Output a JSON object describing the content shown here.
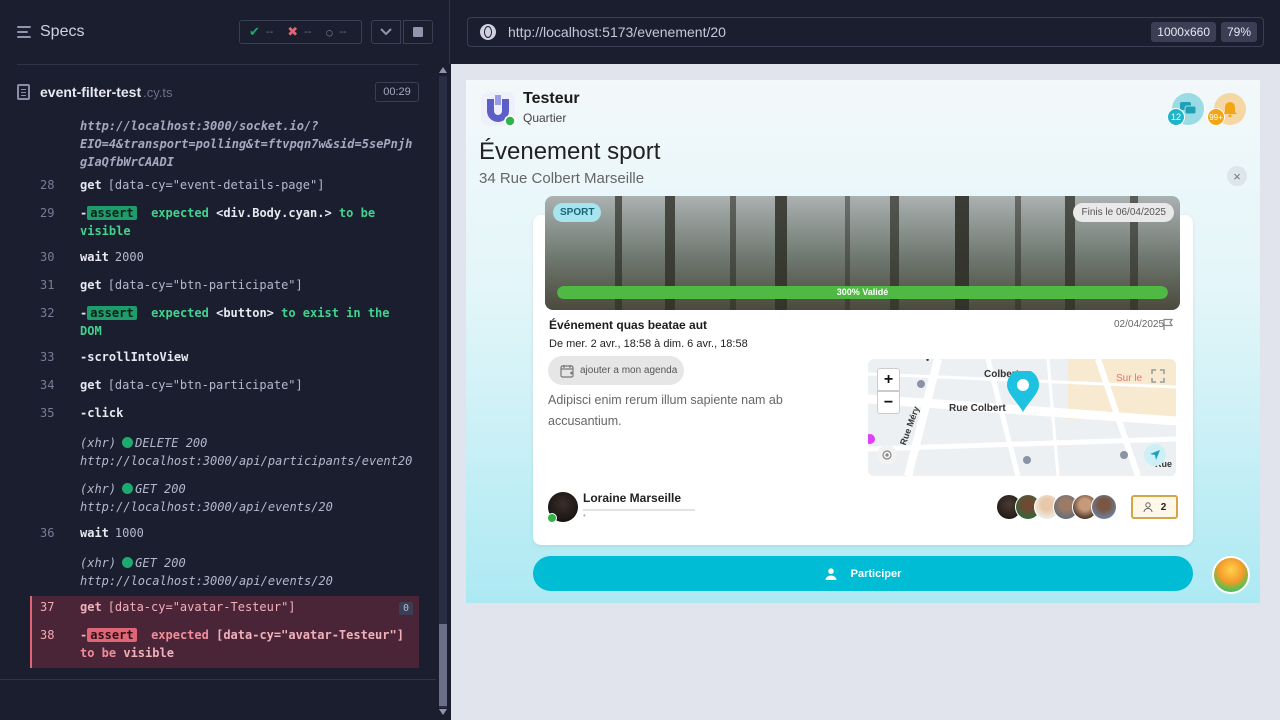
{
  "runner": {
    "title": "Specs",
    "stats": {
      "passed": "--",
      "failed": "--",
      "pending": "--"
    },
    "spec": {
      "name": "event-filter-test",
      "ext": ".cy.ts",
      "time": "00:29"
    }
  },
  "log": {
    "url_tail": [
      "http://localhost:3000/socket.io/?",
      "EIO=4&transport=polling&t=ftvpqn7w&sid=5sePnjh",
      "gIaQfbWrCAADI"
    ],
    "cmd28": {
      "num": "28",
      "name": "get",
      "sel": "[data-cy=\"event-details-page\"]"
    },
    "cmd29": {
      "num": "29",
      "dash": "-",
      "badge": "assert",
      "expected": "expected",
      "subject": "<div.Body.cyan.>",
      "rest1": "to be",
      "rest2": "visible"
    },
    "cmd30": {
      "num": "30",
      "name": "wait",
      "sel": "2000"
    },
    "cmd31": {
      "num": "31",
      "name": "get",
      "sel": "[data-cy=\"btn-participate\"]"
    },
    "cmd32": {
      "num": "32",
      "dash": "-",
      "badge": "assert",
      "expected": "expected",
      "subject": "<button>",
      "rest1": "to exist in the",
      "rest2": "DOM"
    },
    "cmd33": {
      "num": "33",
      "name": "-scrollIntoView"
    },
    "cmd34": {
      "num": "34",
      "name": "get",
      "sel": "[data-cy=\"btn-participate\"]"
    },
    "cmd35": {
      "num": "35",
      "name": "-click"
    },
    "xhr1": {
      "label": "(xhr)",
      "method": "DELETE 200",
      "url": "http://localhost:3000/api/participants/event20"
    },
    "xhr2": {
      "label": "(xhr)",
      "method": "GET 200",
      "url": "http://localhost:3000/api/events/20"
    },
    "cmd36": {
      "num": "36",
      "name": "wait",
      "sel": "1000"
    },
    "xhr3": {
      "label": "(xhr)",
      "method": "GET 200",
      "url": "http://localhost:3000/api/events/20"
    },
    "cmd37": {
      "num": "37",
      "name": "get",
      "sel": "[data-cy=\"avatar-Testeur\"]",
      "count": "0"
    },
    "cmd38": {
      "num": "38",
      "dash": "-",
      "badge": "assert",
      "expected": "expected",
      "subject": "[data-cy=\"avatar-Testeur\"]",
      "rest1": "to be",
      "rest2": "visible"
    }
  },
  "preview": {
    "url": "http://localhost:5173/evenement/20",
    "viewport": "1000x660",
    "zoom": "79%"
  },
  "app": {
    "user": {
      "name": "Testeur",
      "role": "Quartier"
    },
    "chat_count": "12",
    "notif_count": "99+",
    "event_title": "Évenement sport",
    "event_address": "34 Rue Colbert Marseille",
    "close": "×",
    "tag": "SPORT",
    "ended": "Finis le 06/04/2025",
    "progress_percent": 300,
    "progress_label": "300% Validé",
    "event_name": "Événement quas beatae aut",
    "event_date": "02/04/2025",
    "event_times": "De mer. 2 avr., 18:58 à dim. 6 avr., 18:58",
    "agenda_label": "ajouter a mon agenda",
    "description": "Adipisci enim rerum illum sapiente nam ab accusantium.",
    "map": {
      "zoom_in": "+",
      "zoom_out": "−",
      "street_main": "Rue Colbert",
      "street_top": "Colbert",
      "street_mery": "Rue Méry",
      "label_right": "Sur le",
      "label_small": "Rue",
      "label_tiny": "•"
    },
    "organizer": {
      "name": "Loraine Marseille",
      "sub": "•"
    },
    "participant_count": "2",
    "participate_label": "Participer"
  },
  "colors": {
    "accent": "#00bcd4",
    "pass": "#42d38e",
    "fail": "#e06575",
    "progress": "#4fb944"
  }
}
